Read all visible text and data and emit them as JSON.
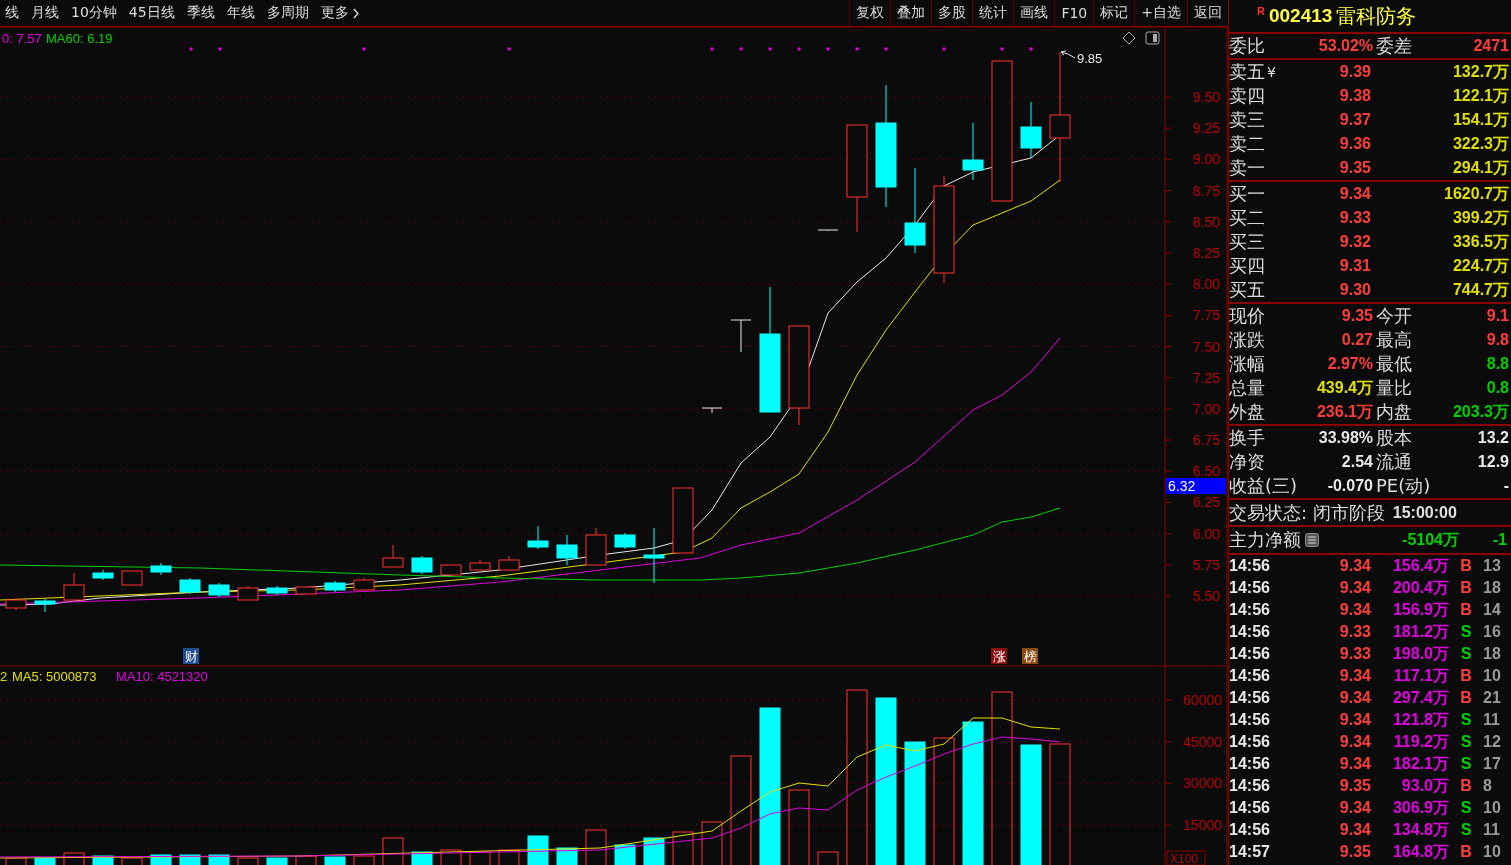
{
  "toolbar": {
    "periods": [
      "线",
      "月线",
      "10分钟",
      "45日线",
      "季线",
      "年线",
      "多周期",
      "更多"
    ],
    "buttons": [
      "复权",
      "叠加",
      "多股",
      "统计",
      "画线",
      "F10",
      "标记",
      "+自选",
      "返回"
    ]
  },
  "price_chart": {
    "legend": [
      {
        "text": "0: 7.57",
        "kind": "ma30"
      },
      {
        "text": "MA60: 6.19",
        "kind": "ma60"
      }
    ],
    "y_labels": [
      "9.50",
      "9.25",
      "9.00",
      "8.75",
      "8.50",
      "8.25",
      "8.00",
      "7.75",
      "7.50",
      "7.25",
      "7.00",
      "6.75",
      "6.50",
      "6.25",
      "6.00",
      "5.75",
      "5.50"
    ],
    "high_label": "9.85",
    "current_price": "6.32",
    "event_tags": [
      {
        "text": "财",
        "kind": "finance"
      },
      {
        "text": "涨",
        "kind": "limit"
      },
      {
        "text": "榜",
        "kind": "rank"
      }
    ]
  },
  "volume_chart": {
    "legend": [
      {
        "text": "2",
        "kind": "vol"
      },
      {
        "text": "MA5: 5000873",
        "kind": "ma5"
      },
      {
        "text": "MA10: 4521320",
        "kind": "ma10"
      }
    ],
    "y_labels": [
      "60000",
      "45000",
      "30000",
      "15000"
    ],
    "unit": "X100"
  },
  "quote": {
    "flag": "R",
    "code": "002413",
    "name": "雷科防务",
    "ratio": {
      "label": "委比",
      "value": "53.02%",
      "label2": "委差",
      "value2": "2471"
    },
    "asks": [
      {
        "label": "卖五",
        "mark": "¥",
        "price": "9.39",
        "volume": "132.7万"
      },
      {
        "label": "卖四",
        "price": "9.38",
        "volume": "122.1万"
      },
      {
        "label": "卖三",
        "price": "9.37",
        "volume": "154.1万"
      },
      {
        "label": "卖二",
        "price": "9.36",
        "volume": "322.3万"
      },
      {
        "label": "卖一",
        "price": "9.35",
        "volume": "294.1万"
      }
    ],
    "bids": [
      {
        "label": "买一",
        "price": "9.34",
        "volume": "1620.7万"
      },
      {
        "label": "买二",
        "price": "9.33",
        "volume": "399.2万"
      },
      {
        "label": "买三",
        "price": "9.32",
        "volume": "336.5万"
      },
      {
        "label": "买四",
        "price": "9.31",
        "volume": "224.7万"
      },
      {
        "label": "买五",
        "price": "9.30",
        "volume": "744.7万"
      }
    ],
    "stats": [
      [
        {
          "label": "现价",
          "value": "9.35",
          "kind": "up"
        },
        {
          "label": "今开",
          "value": "9.1",
          "kind": "up"
        }
      ],
      [
        {
          "label": "涨跌",
          "value": "0.27",
          "kind": "up"
        },
        {
          "label": "最高",
          "value": "9.8",
          "kind": "up"
        }
      ],
      [
        {
          "label": "涨幅",
          "value": "2.97%",
          "kind": "up"
        },
        {
          "label": "最低",
          "value": "8.8",
          "kind": "down"
        }
      ],
      [
        {
          "label": "总量",
          "value": "439.4万",
          "kind": "volume"
        },
        {
          "label": "量比",
          "value": "0.8",
          "kind": "down"
        }
      ],
      [
        {
          "label": "外盘",
          "value": "236.1万",
          "kind": "up"
        },
        {
          "label": "内盘",
          "value": "203.3万",
          "kind": "down"
        }
      ]
    ],
    "finance": [
      [
        {
          "label": "换手",
          "value": "33.98%"
        },
        {
          "label": "股本",
          "value": "13.2"
        }
      ],
      [
        {
          "label": "净资",
          "value": "2.54"
        },
        {
          "label": "流通",
          "value": "12.9"
        }
      ],
      [
        {
          "label": "收益(三)",
          "value": "-0.070"
        },
        {
          "label": "PE(动)",
          "value": "-"
        }
      ]
    ],
    "status": {
      "text": "交易状态: 闭市阶段",
      "time": "15:00:00"
    },
    "main_flow": {
      "label": "主力净额",
      "value": "-5104万",
      "percent": "-1"
    },
    "trades": [
      {
        "time": "14:56",
        "price": "9.34",
        "amount": "156.4万",
        "side": "B",
        "kind": "buy",
        "count": "13"
      },
      {
        "time": "14:56",
        "price": "9.34",
        "amount": "200.4万",
        "side": "B",
        "kind": "buy",
        "count": "18"
      },
      {
        "time": "14:56",
        "price": "9.34",
        "amount": "156.9万",
        "side": "B",
        "kind": "buy",
        "count": "14"
      },
      {
        "time": "14:56",
        "price": "9.33",
        "amount": "181.2万",
        "side": "S",
        "kind": "sell",
        "count": "16"
      },
      {
        "time": "14:56",
        "price": "9.33",
        "amount": "198.0万",
        "side": "S",
        "kind": "sell",
        "count": "18"
      },
      {
        "time": "14:56",
        "price": "9.34",
        "amount": "117.1万",
        "side": "B",
        "kind": "buy",
        "count": "10"
      },
      {
        "time": "14:56",
        "price": "9.34",
        "amount": "297.4万",
        "side": "B",
        "kind": "buy",
        "count": "21"
      },
      {
        "time": "14:56",
        "price": "9.34",
        "amount": "121.8万",
        "side": "S",
        "kind": "sell",
        "count": "11"
      },
      {
        "time": "14:56",
        "price": "9.34",
        "amount": "119.2万",
        "side": "S",
        "kind": "sell",
        "count": "12"
      },
      {
        "time": "14:56",
        "price": "9.34",
        "amount": "182.1万",
        "side": "S",
        "kind": "sell",
        "count": "17"
      },
      {
        "time": "14:56",
        "price": "9.35",
        "amount": "93.0万",
        "side": "B",
        "kind": "buy",
        "count": "8"
      },
      {
        "time": "14:56",
        "price": "9.34",
        "amount": "306.9万",
        "side": "S",
        "kind": "sell",
        "count": "10"
      },
      {
        "time": "14:56",
        "price": "9.34",
        "amount": "134.8万",
        "side": "S",
        "kind": "sell",
        "count": "11"
      },
      {
        "time": "14:57",
        "price": "9.35",
        "amount": "164.8万",
        "side": "B",
        "kind": "buy",
        "count": "10"
      }
    ]
  }
}
